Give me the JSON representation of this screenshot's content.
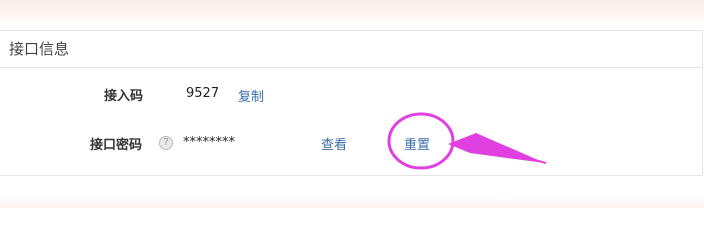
{
  "panel": {
    "title": "接口信息"
  },
  "access_code": {
    "label": "接入码",
    "value": "9527",
    "copy_label": "复制"
  },
  "api_password": {
    "label": "接口密码",
    "value": "********",
    "view_label": "查看",
    "reset_label": "重置"
  },
  "annotation": {
    "color": "#e040e0"
  }
}
